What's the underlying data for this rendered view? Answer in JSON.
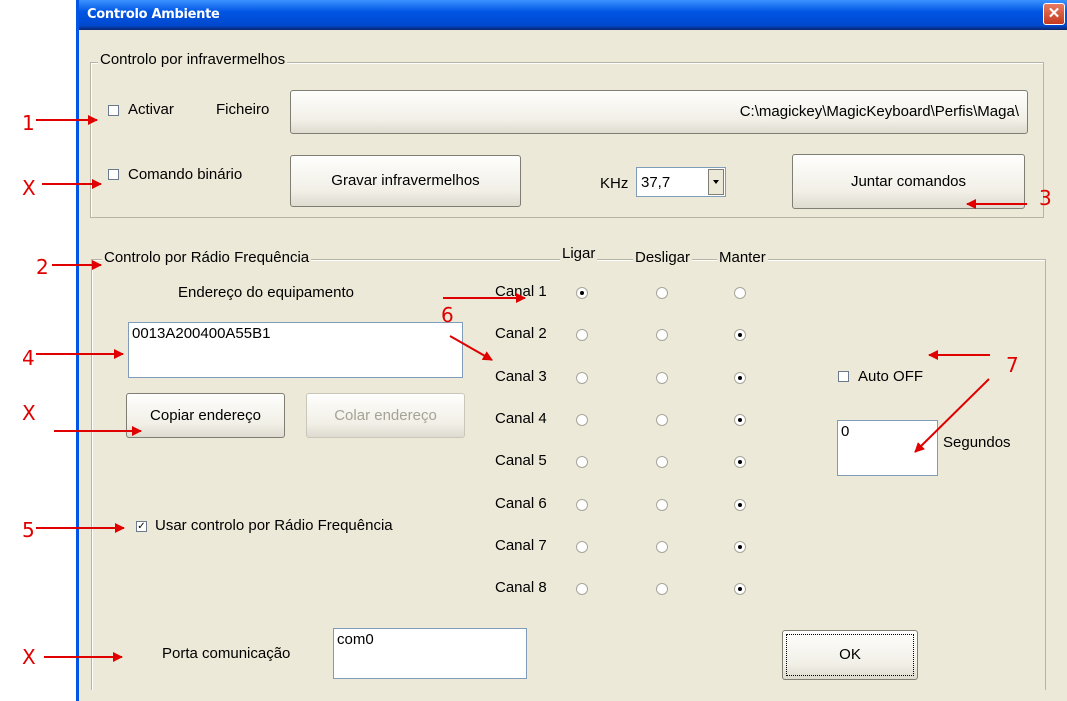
{
  "window": {
    "title": "Controlo Ambiente",
    "close_label": "✕"
  },
  "infrared": {
    "legend": "Controlo por infravermelhos",
    "activate_label": "Activar",
    "activate_checked": false,
    "file_label": "Ficheiro",
    "file_path": "C:\\magickey\\MagicKeyboard\\Perfis\\Maga\\",
    "binary_label": "Comando binário",
    "binary_checked": false,
    "record_button": "Gravar infravermelhos",
    "khz_label": "KHz",
    "khz_value": "37,7",
    "merge_button": "Juntar comandos"
  },
  "rf": {
    "legend": "Controlo por Rádio Frequência",
    "col_on": "Ligar",
    "col_off": "Desligar",
    "col_keep": "Manter",
    "address_label": "Endereço do equipamento",
    "address_value": "0013A200400A55B1",
    "copy_button": "Copiar endereço",
    "paste_button": "Colar endereço",
    "use_rf_label": "Usar controlo por Rádio Frequência",
    "use_rf_checked": true,
    "channels": [
      {
        "label": "Canal 1",
        "selected": "on"
      },
      {
        "label": "Canal 2",
        "selected": "keep"
      },
      {
        "label": "Canal 3",
        "selected": "keep"
      },
      {
        "label": "Canal 4",
        "selected": "keep"
      },
      {
        "label": "Canal 5",
        "selected": "keep"
      },
      {
        "label": "Canal 6",
        "selected": "keep"
      },
      {
        "label": "Canal 7",
        "selected": "keep"
      },
      {
        "label": "Canal 8",
        "selected": "keep"
      }
    ],
    "auto_off_label": "Auto OFF",
    "auto_off_checked": false,
    "seconds_value": "0",
    "seconds_label": "Segundos",
    "port_label": "Porta comunicação",
    "port_value": "com0",
    "ok_button": "OK"
  },
  "annotations": [
    "1",
    "X",
    "2",
    "4",
    "X",
    "5",
    "X",
    "3",
    "6",
    "7"
  ],
  "colors": {
    "annotation": "#e00000",
    "titlebar": "#0054e3",
    "dialog_bg": "#ece9d8"
  }
}
